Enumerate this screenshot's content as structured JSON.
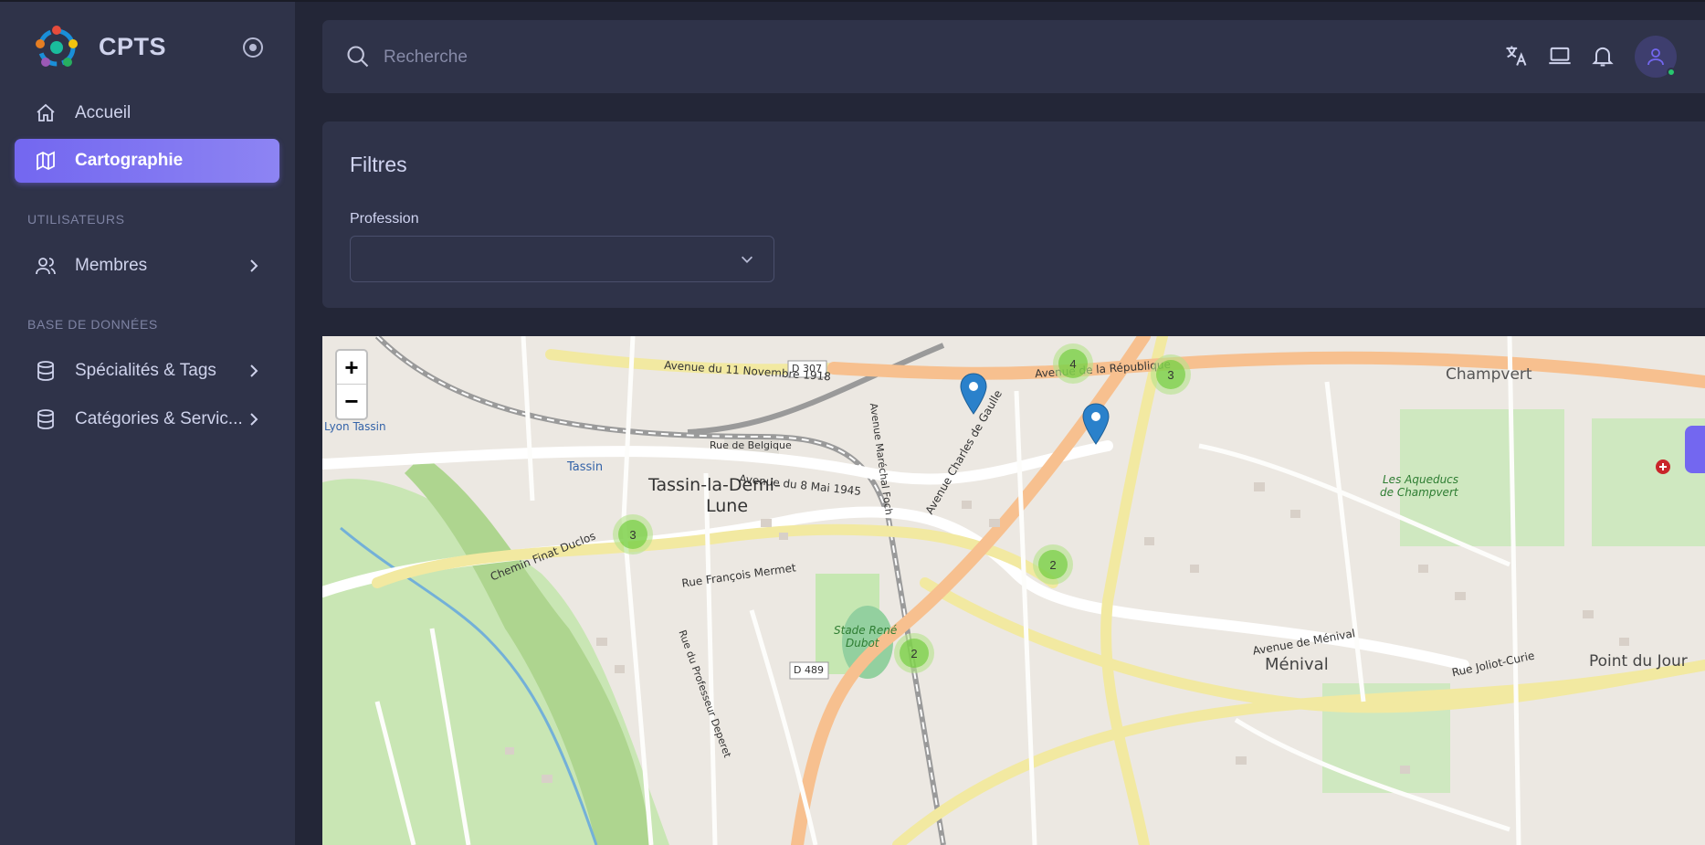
{
  "app": {
    "name": "CPTS"
  },
  "sidebar": {
    "items": [
      {
        "label": "Accueil",
        "icon": "home-icon"
      },
      {
        "label": "Cartographie",
        "icon": "map-icon",
        "active": true
      }
    ],
    "sections": [
      {
        "title": "UTILISATEURS",
        "items": [
          {
            "label": "Membres",
            "icon": "users-icon"
          }
        ]
      },
      {
        "title": "BASE DE DONNÉES",
        "items": [
          {
            "label": "Spécialités & Tags",
            "icon": "database-icon"
          },
          {
            "label": "Catégories & Servic...",
            "icon": "database-icon"
          }
        ]
      }
    ]
  },
  "topbar": {
    "search_placeholder": "Recherche",
    "icons": [
      "translate-icon",
      "laptop-icon",
      "bell-icon",
      "user-avatar-icon"
    ]
  },
  "filters": {
    "title": "Filtres",
    "profession": {
      "label": "Profession",
      "value": ""
    }
  },
  "map": {
    "zoom_in": "+",
    "zoom_out": "−",
    "place_labels": [
      "Tassin-la-Demi-",
      "Lune",
      "Champvert",
      "Ménival",
      "Point du Jour",
      "Tassin",
      "Stade René",
      "Dubot",
      "Les Aqueducs",
      "de Champvert",
      "Lyon Tassin"
    ],
    "road_labels": [
      "Avenue du 11 Novembre 1918",
      "Avenue du 8 Mai 1945",
      "Rue François Mermet",
      "Avenue Charles de Gaulle",
      "Avenue de Ménival",
      "Rue Joliot-Curie",
      "Chemin Finat Duclos",
      "Rue de Belgique",
      "Avenue Maréchal Foch",
      "Rue du Professeur Deperet",
      "Avenue de la République"
    ],
    "route_shields": [
      "D 307",
      "D 489"
    ],
    "clusters": [
      {
        "count": "4"
      },
      {
        "count": "3"
      },
      {
        "count": "3"
      },
      {
        "count": "2"
      },
      {
        "count": "2"
      }
    ],
    "markers": 2,
    "colors": {
      "marker": "#2a81cb",
      "cluster": "#6ecc39",
      "accent": "#7367f0"
    }
  }
}
